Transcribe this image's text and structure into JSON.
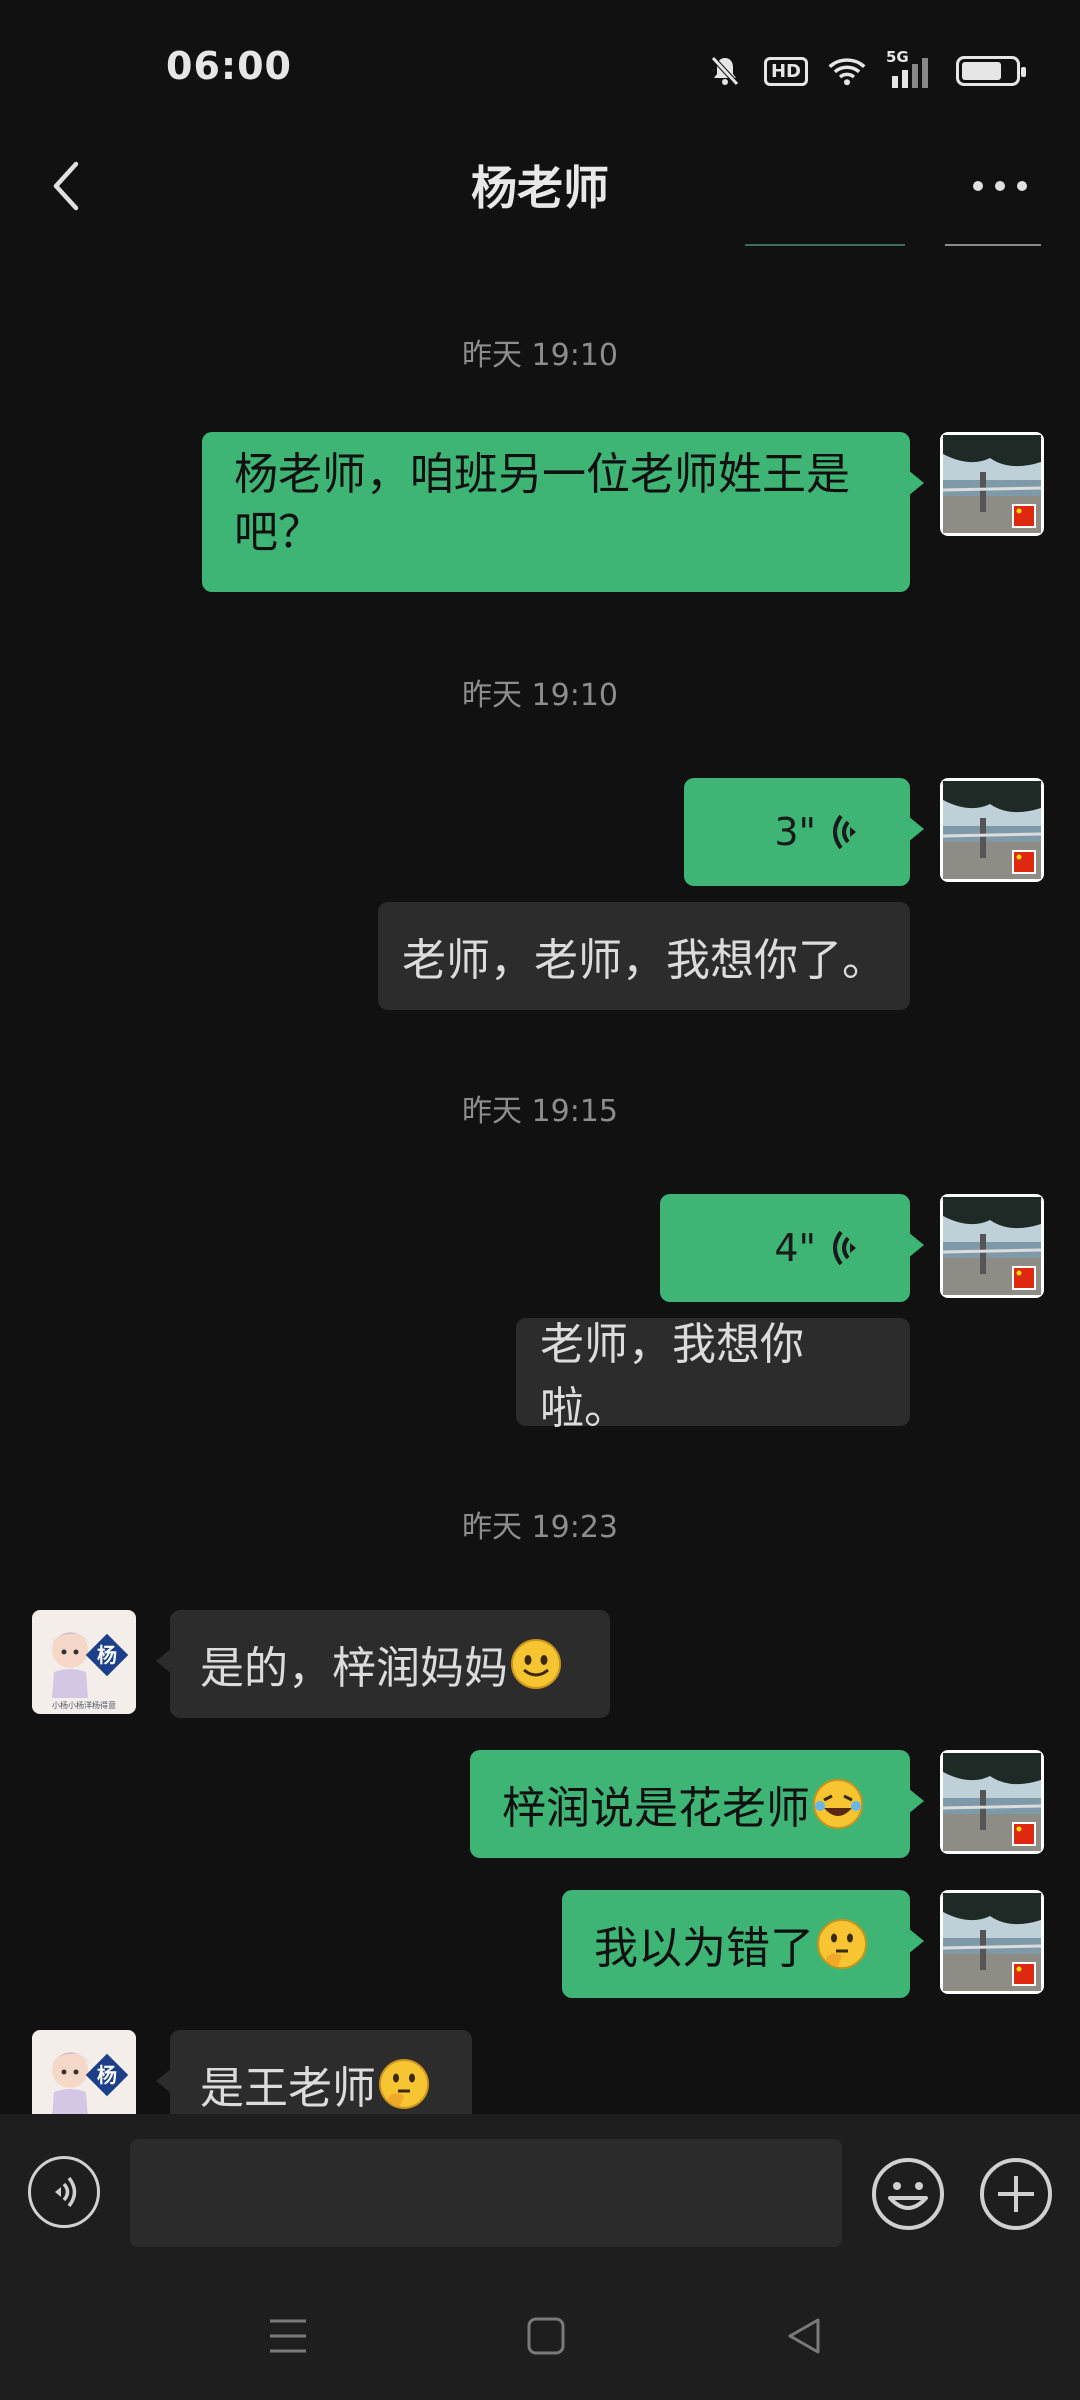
{
  "status_bar": {
    "time": "06:00",
    "hd": "HD",
    "network": "5G",
    "battery_level": 0.75
  },
  "header": {
    "title": "杨老师"
  },
  "colors": {
    "sent_bubble": "#3eb575",
    "received_bubble": "#2c2c2c",
    "background": "#111111"
  },
  "messages": {
    "ts1": "昨天 19:10",
    "m1": "杨老师，咱班另一位老师姓王是吧？",
    "ts2": "昨天 19:10",
    "voice1": "3\"",
    "transcript1": "老师，老师，我想你了。",
    "ts3": "昨天 19:15",
    "voice2": "4\"",
    "transcript2": "老师，我想你啦。",
    "ts4": "昨天 19:23",
    "r1": "是的，梓润妈妈",
    "m2": "梓润说是花老师",
    "m3": "我以为错了",
    "r2": "是王老师"
  },
  "avatar": {
    "teacher_text": "杨",
    "teacher_caption": "小杨小杨洋杨得意"
  },
  "input": {
    "value": "",
    "placeholder": ""
  },
  "icons": {
    "back": "chevron-left-icon",
    "more": "more-dots-icon",
    "voice": "voice-icon",
    "emoji": "smiley-icon",
    "plus": "plus-icon"
  }
}
